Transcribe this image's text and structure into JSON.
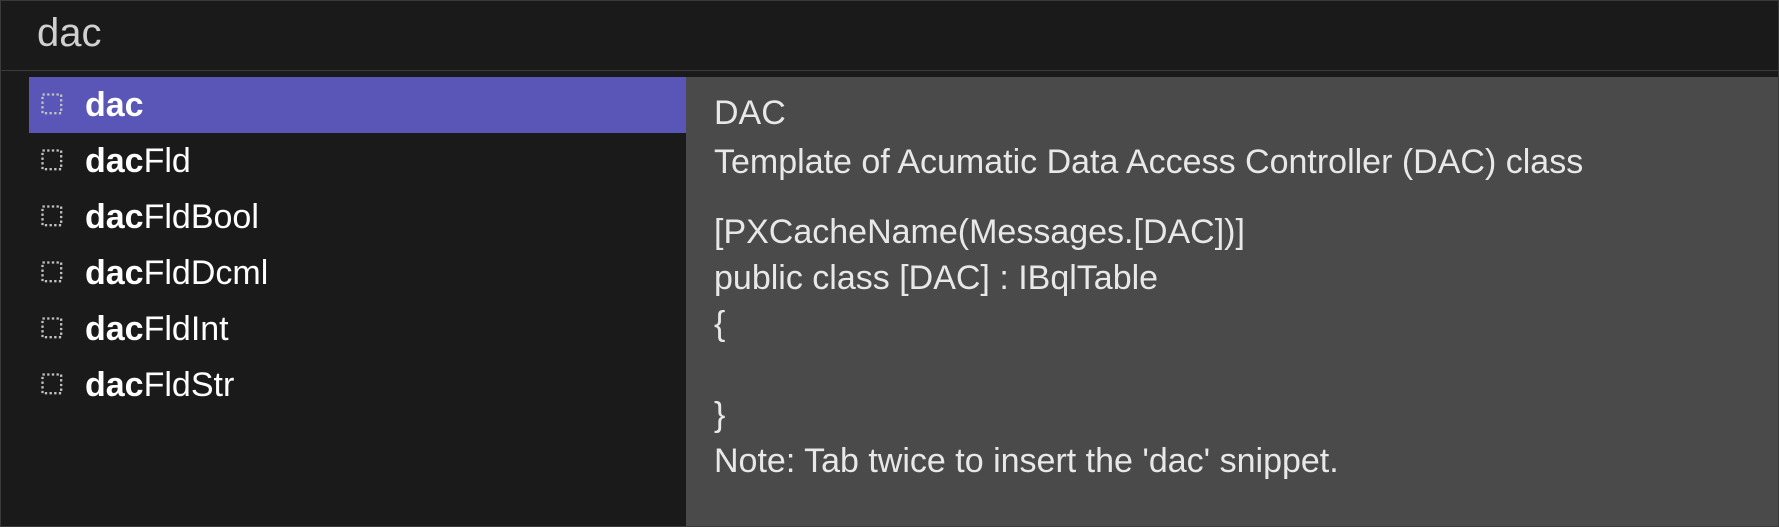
{
  "search": {
    "value": "dac"
  },
  "items": [
    {
      "prefix": "dac",
      "suffix": "",
      "selected": true
    },
    {
      "prefix": "dac",
      "suffix": "Fld",
      "selected": false
    },
    {
      "prefix": "dac",
      "suffix": "FldBool",
      "selected": false
    },
    {
      "prefix": "dac",
      "suffix": "FldDcml",
      "selected": false
    },
    {
      "prefix": "dac",
      "suffix": "FldInt",
      "selected": false
    },
    {
      "prefix": "dac",
      "suffix": "FldStr",
      "selected": false
    }
  ],
  "details": {
    "title": "DAC",
    "description": "Template of Acumatic Data Access Controller (DAC) class",
    "code": "[PXCacheName(Messages.[DAC])]\npublic class [DAC] : IBqlTable\n{\n\n}",
    "note": "Note: Tab twice to insert the 'dac' snippet."
  }
}
